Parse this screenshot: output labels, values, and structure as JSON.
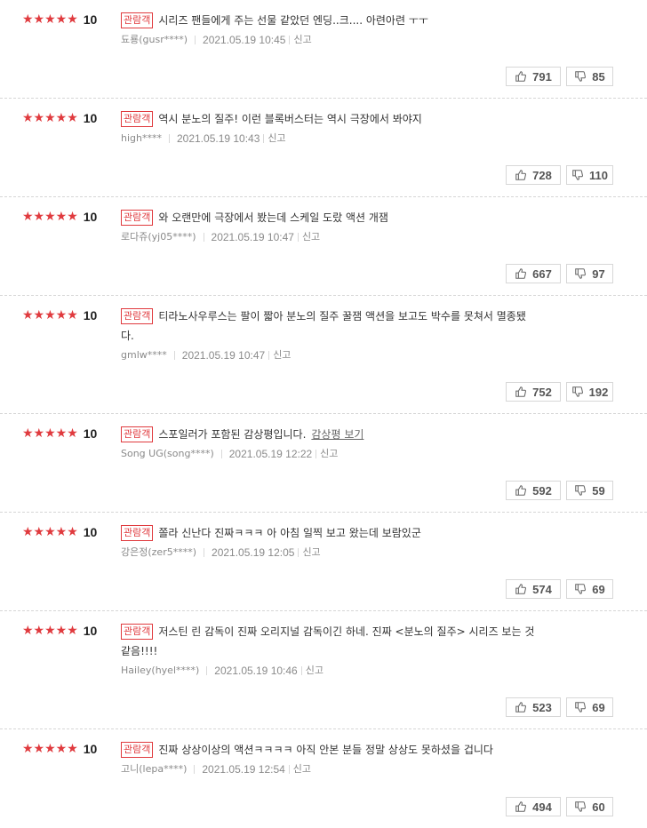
{
  "labels": {
    "badge": "관람객",
    "report": "신고",
    "spoiler_link": "감상평 보기",
    "stars": "★★★★★"
  },
  "colors": {
    "star": "#e03a3e",
    "badge": "#e03a3e"
  },
  "reviews": [
    {
      "score": "10",
      "text": "시리즈 팬들에게 주는 선물 같았던 엔딩..크.... 아련아련 ㅜㅜ",
      "text2": "",
      "author": "됴룡(gusr****)",
      "date": "2021.05.19 10:45",
      "likes": "791",
      "dislikes": "85",
      "spoiler": false
    },
    {
      "score": "10",
      "text": "역시 분노의 질주! 이런 블록버스터는 역시 극장에서 봐야지",
      "text2": "",
      "author": "high****",
      "date": "2021.05.19 10:43",
      "likes": "728",
      "dislikes": "110",
      "spoiler": false
    },
    {
      "score": "10",
      "text": "와 오랜만에 극장에서 봤는데 스케일 도랐 액션 개잼",
      "text2": "",
      "author": "로다쥬(yj05****)",
      "date": "2021.05.19 10:47",
      "likes": "667",
      "dislikes": "97",
      "spoiler": false
    },
    {
      "score": "10",
      "text": "티라노사우루스는 팔이 짧아 분노의 질주 꿀잼 액션을 보고도 박수를 못쳐서 멸종됐",
      "text2": "다.",
      "author": "gmlw****",
      "date": "2021.05.19 10:47",
      "likes": "752",
      "dislikes": "192",
      "spoiler": false
    },
    {
      "score": "10",
      "text": "스포일러가 포함된 감상평입니다.",
      "text2": "",
      "author": "Song UG(song****)",
      "date": "2021.05.19 12:22",
      "likes": "592",
      "dislikes": "59",
      "spoiler": true
    },
    {
      "score": "10",
      "text": "쫄라 신난다 진짜ㅋㅋㅋ 아 아침 일찍 보고 왔는데 보람있군",
      "text2": "",
      "author": "강은정(zer5****)",
      "date": "2021.05.19 12:05",
      "likes": "574",
      "dislikes": "69",
      "spoiler": false
    },
    {
      "score": "10",
      "text": "저스틴 린 감독이 진짜 오리지널 감독이긴 하네. 진짜 <분노의 질주> 시리즈 보는 것",
      "text2": "같음!!!!",
      "author": "Hailey(hyel****)",
      "date": "2021.05.19 10:46",
      "likes": "523",
      "dislikes": "69",
      "spoiler": false
    },
    {
      "score": "10",
      "text": "진짜 상상이상의 액션ㅋㅋㅋㅋ 아직 안본 분들 정말 상상도 못하셨을 겁니다",
      "text2": "",
      "author": "고니(lepa****)",
      "date": "2021.05.19 12:54",
      "likes": "494",
      "dislikes": "60",
      "spoiler": false
    }
  ]
}
